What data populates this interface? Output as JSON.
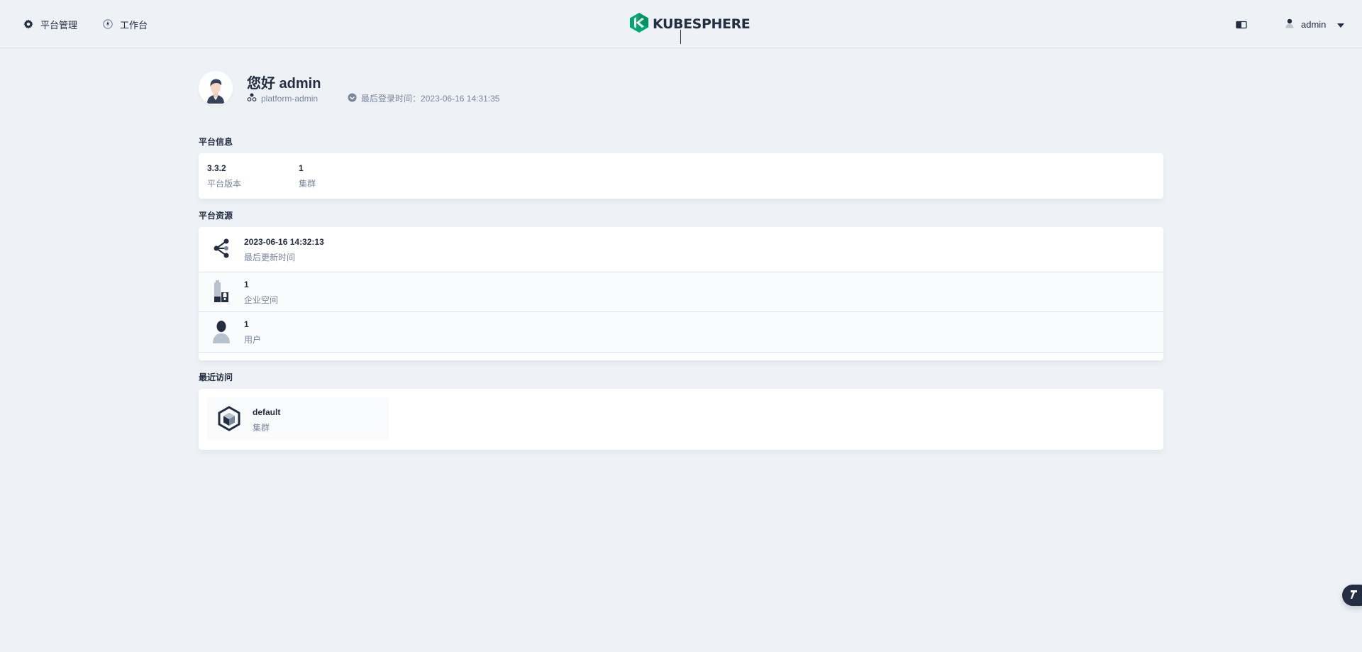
{
  "header": {
    "nav": [
      {
        "label": "平台管理",
        "icon": "gear-icon"
      },
      {
        "label": "工作台",
        "icon": "compass-icon"
      }
    ],
    "logo_text": "KUBESPHERE",
    "user": {
      "name": "admin",
      "icon": "user-icon"
    }
  },
  "greeting": {
    "title": "您好 admin",
    "role": "platform-admin",
    "last_login_label": "最后登录时间：",
    "last_login_value": "2023-06-16 14:31:35"
  },
  "platform_info": {
    "title": "平台信息",
    "stats": [
      {
        "value": "3.3.2",
        "label": "平台版本"
      },
      {
        "value": "1",
        "label": "集群"
      }
    ]
  },
  "platform_resources": {
    "title": "平台资源",
    "rows": [
      {
        "value": "2023-06-16 14:32:13",
        "label": "最后更新时间",
        "icon": "share-nodes-icon"
      },
      {
        "value": "1",
        "label": "企业空间",
        "icon": "workspace-icon"
      },
      {
        "value": "1",
        "label": "用户",
        "icon": "human-icon"
      }
    ]
  },
  "recent": {
    "title": "最近访问",
    "items": [
      {
        "name": "default",
        "type": "集群",
        "icon": "cluster-icon"
      }
    ]
  },
  "colors": {
    "background": "#eef2f7",
    "text": "#242e42",
    "muted": "#79879c",
    "brand": "#00a971"
  }
}
